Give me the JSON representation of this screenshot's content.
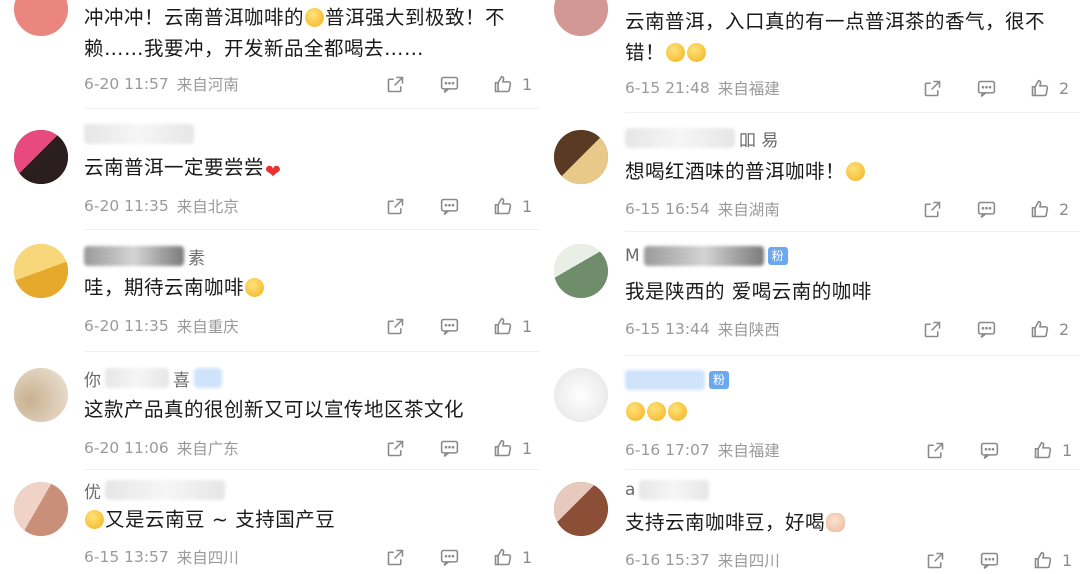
{
  "left": [
    {
      "username": "",
      "text_parts": [
        "冲冲冲！云南普洱咖啡的",
        "普洱强大到极致！不赖……我要冲，开发新品全都喝去……"
      ],
      "emoji_after": 0,
      "emoji_kind": "yellow",
      "time": "6-20 11:57",
      "loc": "来自河南",
      "likes": "1"
    },
    {
      "username": "",
      "text_parts": [
        "云南普洱一定要尝尝"
      ],
      "emoji_after": 1,
      "emoji_kind": "heart",
      "time": "6-20 11:35",
      "loc": "来自北京",
      "likes": "1"
    },
    {
      "username": "素",
      "text_parts": [
        "哇，期待云南咖啡"
      ],
      "emoji_after": 1,
      "emoji_kind": "yellow",
      "time": "6-20 11:35",
      "loc": "来自重庆",
      "likes": "1"
    },
    {
      "username": "你",
      "username_tail": "喜",
      "text_parts": [
        "这款产品真的很创新又可以宣传地区茶文化"
      ],
      "emoji_after": -1,
      "emoji_kind": "",
      "time": "6-20 11:06",
      "loc": "来自广东",
      "likes": "1"
    },
    {
      "username": "优",
      "text_parts": [
        "",
        "又是云南豆 ~ 支持国产豆"
      ],
      "emoji_after": 0,
      "emoji_kind": "yellow",
      "time": "6-15 13:57",
      "loc": "来自四川",
      "likes": "1"
    }
  ],
  "right": [
    {
      "username": "",
      "text_parts": [
        "云南普洱，入口真的有一点普洱茶的香气，很不错！"
      ],
      "emoji_after": 1,
      "emoji_kind": "yellow2",
      "time": "6-15 21:48",
      "loc": "来自福建",
      "likes": "2"
    },
    {
      "username": "",
      "username_tail": "吅   易",
      "text_parts": [
        "想喝红酒味的普洱咖啡！"
      ],
      "emoji_after": 1,
      "emoji_kind": "yellow",
      "time": "6-15 16:54",
      "loc": "来自湖南",
      "likes": "2"
    },
    {
      "username": "M",
      "badge": "粉",
      "text_parts": [
        "我是陕西的 爱喝云南的咖啡"
      ],
      "emoji_after": -1,
      "emoji_kind": "",
      "time": "6-15 13:44",
      "loc": "来自陕西",
      "likes": "2"
    },
    {
      "username": "",
      "badge": "粉",
      "text_parts": [
        ""
      ],
      "emoji_after": 0,
      "emoji_kind": "yellow3",
      "time": "6-16 17:07",
      "loc": "来自福建",
      "likes": "1"
    },
    {
      "username": "a",
      "text_parts": [
        "支持云南咖啡豆，好喝"
      ],
      "emoji_after": 1,
      "emoji_kind": "hand",
      "time": "6-16 15:37",
      "loc": "来自四川",
      "likes": "1"
    }
  ]
}
